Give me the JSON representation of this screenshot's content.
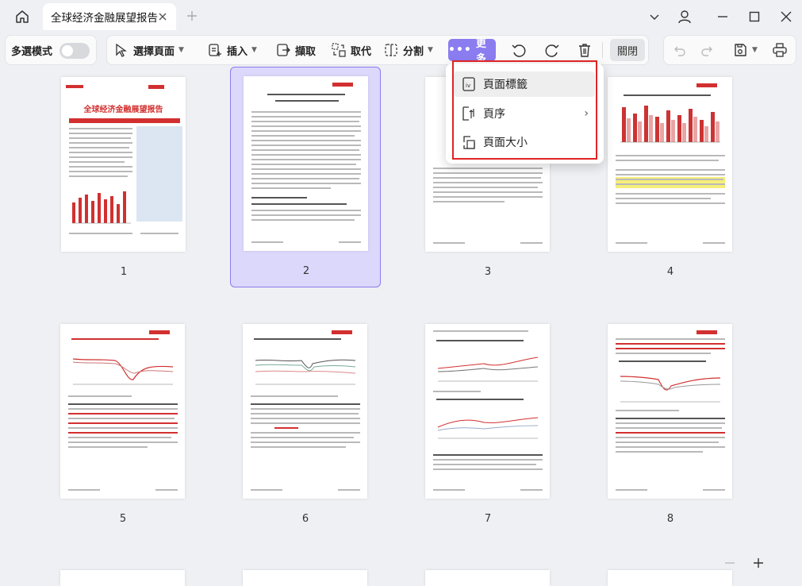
{
  "tab": {
    "title": "全球经济金融展望报告"
  },
  "toolbar": {
    "multi_select_label": "多選模式",
    "select_pages": "選擇頁面",
    "insert": "插入",
    "extract": "擷取",
    "replace": "取代",
    "split": "分割",
    "more": "更多",
    "close": "關閉"
  },
  "dropdown": {
    "items": [
      {
        "label": "頁面標籤",
        "icon": "page-label-icon"
      },
      {
        "label": "頁序",
        "icon": "page-order-icon"
      },
      {
        "label": "頁面大小",
        "icon": "page-size-icon"
      }
    ]
  },
  "pages": [
    {
      "number": "1",
      "title": "全球经济金融展望报告"
    },
    {
      "number": "2"
    },
    {
      "number": "3"
    },
    {
      "number": "4"
    },
    {
      "number": "5"
    },
    {
      "number": "6"
    },
    {
      "number": "7"
    },
    {
      "number": "8"
    }
  ],
  "colors": {
    "accent": "#8b7cf0",
    "highlight_border": "#e02424",
    "selection_bg": "#dcd8fb"
  }
}
